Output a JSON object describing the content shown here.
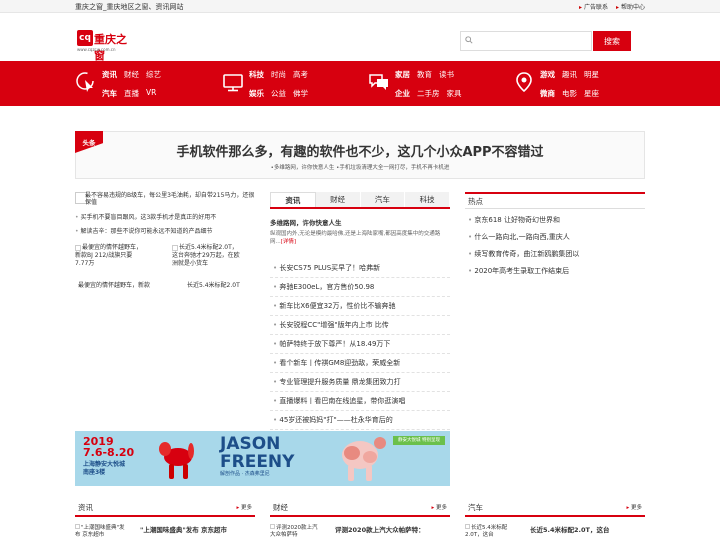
{
  "topbar": {
    "site_title": "重庆之窗_重庆地区之窗、资讯网站",
    "links": [
      "广告联系",
      "帮助中心"
    ]
  },
  "logo": {
    "mark": "cq",
    "name": "重庆之窗",
    "url": "www.cqzcw.com.cn"
  },
  "search": {
    "placeholder": "",
    "button": "搜索",
    "icon": "search-icon"
  },
  "colors": {
    "brand_red": "#d7000f"
  },
  "nav": [
    {
      "icon": "cursor-icon",
      "row1": [
        "资讯",
        "财经",
        "综艺"
      ],
      "row2": [
        "汽车",
        "直播",
        "VR"
      ]
    },
    {
      "icon": "monitor-icon",
      "row1": [
        "科技",
        "时尚",
        "高考"
      ],
      "row2": [
        "娱乐",
        "公益",
        "佛学"
      ]
    },
    {
      "icon": "chat-icon",
      "row1": [
        "家居",
        "教育",
        "读书"
      ],
      "row2": [
        "企业",
        "二手房",
        "家具"
      ]
    },
    {
      "icon": "location-icon",
      "row1": [
        "游戏",
        "趣讯",
        "明星"
      ],
      "row2": [
        "微商",
        "电影",
        "星座"
      ]
    }
  ],
  "headline": {
    "tag": "头条",
    "title": "手机软件那么多，有趣的软件也不少，这几个小众APP不容错过",
    "subs": "•多维路网，许你快意人生   •手机垃圾清理大全一网打尽，手机不再卡机进"
  },
  "left": {
    "big_caption": "最不容易违规的B级车，每公里3毛油耗，却自带215马力，还很保值",
    "bullets": [
      "买手机不要盲目跟风，这3款手机才是真正的好用不",
      "解读吉辛：那些不说你可能永远不知道的产品细节"
    ],
    "pics": [
      {
        "alt": "最便宜的情怀越野车，新款BJ 212/战旗只要7.77万",
        "caption": "最便宜的情怀越野车，新款"
      },
      {
        "alt": "长近5.4米标配2.0T，这台奔驰才29万起，在欧洲就是小货车",
        "caption": "长近5.4米标配2.0T"
      }
    ]
  },
  "middle": {
    "tabs": [
      "资讯",
      "财经",
      "汽车",
      "科技"
    ],
    "lead_title": "多维路网，许你快意人生",
    "lead_desc": "纵观国内外,无论是模约最哈佛,还是上海陆家嘴,都因高度集中的交通路网...",
    "lead_more": "[详情]",
    "items": [
      "长安CS75 PLUS买早了！哈弗新",
      "奔驰E300eL，官方售价50.98",
      "新车比X6便宜32万，性价比不输奔驰",
      "长安锐程CC\"增强\"版年内上市 比传",
      "帕萨特终于放下尊严！从18.49万下",
      "看个新车丨传祺GM8迎劲敌，荣威全新",
      "专业管理提升服务质量 鼎龙集团致力打",
      "直播爆料丨看巴南在线追星，带你逛演唱",
      "45岁还被妈妈\"打\"——杜永华育后的"
    ]
  },
  "right": {
    "heading": "热点",
    "items": [
      "京东618 让好物奇幻世界和",
      "什么一路向北,一路向西,重庆人",
      "续写教育传奇，曲江新鸥鹏集团以",
      "2020年高考生录取工作结束后"
    ]
  },
  "banner": {
    "year": "2019",
    "dates": "7.6-8.20",
    "place_line1": "上海静安大悦城",
    "place_line2": "南座3楼",
    "big_line1": "JASON",
    "big_line2": "FREENY",
    "sub": "解剖作品 · 杰森弗里尼",
    "badge": "静安大悦城 特别呈现"
  },
  "sections": [
    {
      "heading": "资讯",
      "more": "更多",
      "pic_alt": "\"上潮国味盛典\"发布 京东超市",
      "title": "\"上潮国味盛典\"发布 京东超市"
    },
    {
      "heading": "财经",
      "more": "更多",
      "pic_alt": "评测2020款上汽大众帕萨特",
      "title": "评测2020款上汽大众帕萨特："
    },
    {
      "heading": "汽车",
      "more": "更多",
      "pic_alt": "长近5.4米标配2.0T，这台",
      "title": "长近5.4米标配2.0T，这台"
    }
  ]
}
